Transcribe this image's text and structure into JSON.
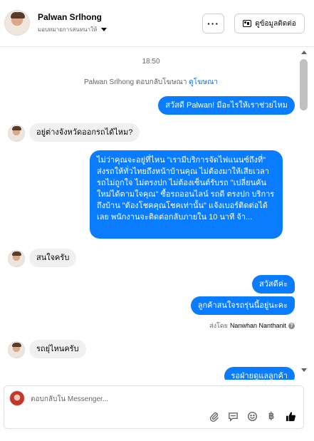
{
  "header": {
    "contact_name": "Palwan Srlhong",
    "assign_label": "มอบหมายการสนทนาให้",
    "more_label": "···",
    "details_label": "ดูข้อมูลติดต่อ"
  },
  "chat": {
    "timestamp": "18:50",
    "ad_reply_prefix": "Palwan Srlhong ตอบกลับโฆษณา",
    "ad_link_label": "ดูโฆษณา",
    "messages": [
      {
        "from": "page",
        "text": "สวัสดี Palwan! มีอะไรให้เราช่วยไหม"
      },
      {
        "from": "contact",
        "text": "อยู่ต่างจังหวัดออกรถได้ไหม?"
      },
      {
        "from": "page",
        "text": "ไม่ว่าคุณจะอยู่ที่ไหน \"เรามีบริการจัดไฟแนนซ์ถึงที่\" ส่งรถให้ทั่วไทยถึงหน้าบ้านคุณ ไม่ต้องมาให้เสียเวลา รถไม่ถูกใจ ไม่ตรงปก ไม่ต้องเซ็นต์รับรถ \"เปลี่ยนคันใหม่ได้ตามใจคุณ\" ซื้อรถออนไลน์ รถดี ตรงปก บริการถึงบ้าน \"ต้องโชคคุณโชคเท่านั้น\" แจ้งเบอร์ติดต่อได้เลย พนักงานจะติดต่อกลับภายใน 10 นาที จ้า..."
      },
      {
        "from": "contact",
        "text": "สนใจครับ"
      },
      {
        "from": "page",
        "text": "สวัสดีค่ะ"
      },
      {
        "from": "page",
        "text": "ลูกค้าสนใจรถรุ่นนี้อยู่นะคะ"
      },
      {
        "from": "contact",
        "text": "รถยุ่ไหนครับ"
      },
      {
        "from": "page",
        "text": "รอฝ่ายดูแลลูกค้า"
      }
    ],
    "sent_by_prefix": "ส่งโดย",
    "sent_by_name": "Nanwhan Nanthanit",
    "help_glyph": "?"
  },
  "composer": {
    "placeholder": "ตอบกลับใน Messenger...",
    "baht_glyph": "฿"
  },
  "colors": {
    "outgoing_bubble": "#0a7cff",
    "incoming_bubble": "#f0f0f0",
    "link": "#1b74e4"
  },
  "icons": [
    "caret-down-icon",
    "contact-card-icon",
    "paperclip-icon",
    "saved-reply-icon",
    "emoji-icon",
    "baht-icon",
    "thumbs-up-icon"
  ]
}
